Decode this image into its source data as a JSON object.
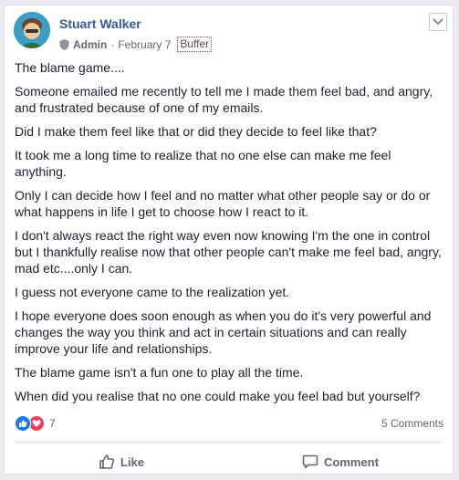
{
  "post": {
    "author": "Stuart Walker",
    "role": "Admin",
    "separator": "·",
    "date": "February 7",
    "app": "Buffer",
    "paragraphs": [
      "The blame game....",
      "Someone emailed me recently to tell me I made them feel bad, and angry, and frustrated because of one of my emails.",
      "Did I make them feel like that or did they decide to feel like that?",
      "It took me a long time to realize that no one else can make me feel anything.",
      "Only I can decide how I feel and no matter what other people say or do or what happens in life I get to choose how I react to it.",
      "I don't always react the right way even now knowing I'm the one in control but I thankfully realise now that other people can't make me feel bad, angry, mad etc....only I can.",
      "I guess not everyone came to the realization yet.",
      "I hope everyone does soon enough as when you do it's very powerful and changes the way you think and act in certain situations and can really improve your life and relationships.",
      "The blame game isn't a fun one to play all the time.",
      "When did you realise that no one could make you feel bad but yourself?"
    ]
  },
  "footer": {
    "reactions_count": "7",
    "comments_count": "5 Comments",
    "like_label": "Like",
    "comment_label": "Comment"
  },
  "colors": {
    "author": "#365899",
    "like": "#1877f2",
    "love": "#f33e58"
  }
}
